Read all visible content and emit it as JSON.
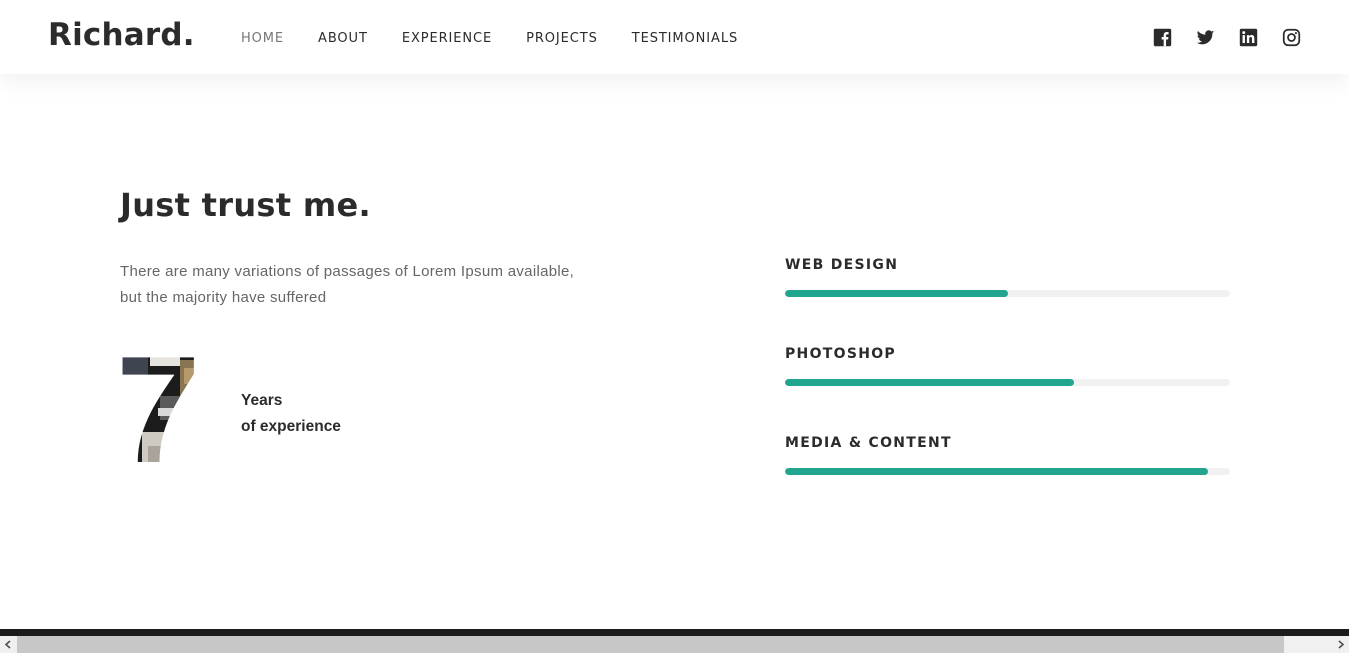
{
  "header": {
    "logo": "Richard.",
    "nav": [
      "HOME",
      "ABOUT",
      "EXPERIENCE",
      "PROJECTS",
      "TESTIMONIALS"
    ],
    "social": [
      "facebook-icon",
      "twitter-icon",
      "linkedin-icon",
      "instagram-icon"
    ]
  },
  "about": {
    "title": "Just trust me.",
    "description": "There are many variations of passages of Lorem Ipsum available, but the majority have suffered",
    "years_number": "7",
    "years_label_line1": "Years",
    "years_label_line2": "of experience"
  },
  "skills": [
    {
      "name": "WEB DESIGN",
      "percent": 50
    },
    {
      "name": "PHOTOSHOP",
      "percent": 65
    },
    {
      "name": "MEDIA & CONTENT",
      "percent": 95
    }
  ],
  "colors": {
    "accent": "#22a58e",
    "text": "#2b2b2b",
    "muted": "#666666"
  }
}
